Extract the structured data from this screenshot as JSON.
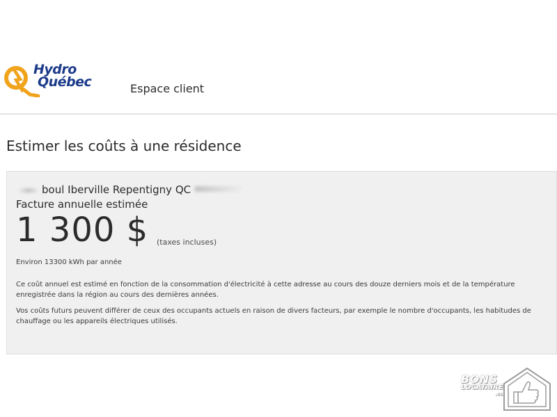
{
  "header": {
    "logo_line1": "Hydro",
    "logo_line2": "Québec",
    "section_title": "Espace client"
  },
  "page_title": "Estimer les coûts à une résidence",
  "estimate": {
    "address": "boul Iberville Repentigny QC",
    "annual_label": "Facture annuelle estimée",
    "amount": "1 300 $",
    "taxes_note": "(taxes incluses)",
    "consumption": "Environ 13300 kWh par année",
    "paragraph1": "Ce coût annuel est estimé en fonction de la consommation d'électricité à cette adresse au cours des douze derniers mois et de la température enregistrée dans la région au cours des dernières années.",
    "paragraph2": "Vos coûts futurs peuvent différer de ceux des occupants actuels en raison de divers facteurs, par exemple le nombre d'occupants, les habitudes de chauffage ou les appareils électriques utilisés."
  },
  "watermark": {
    "line1": "BONS",
    "line2": "LOCATAIRES",
    "line3": ".com"
  },
  "colors": {
    "brand_blue": "#1b3a8a",
    "brand_orange": "#f0a31b",
    "card_background": "#f0f0f1"
  }
}
